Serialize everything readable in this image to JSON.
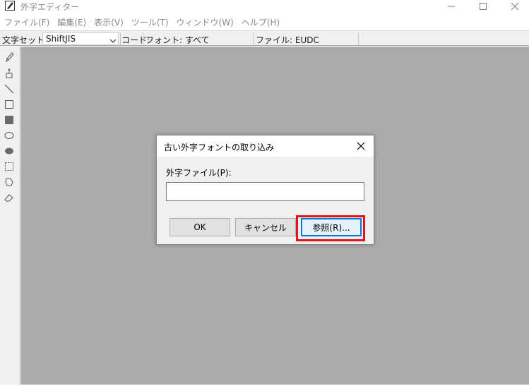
{
  "window": {
    "title": "外字エディター",
    "icon": "pencil-edit-icon",
    "controls": [
      "minimize-icon",
      "maximize-icon",
      "close-icon"
    ]
  },
  "menu": {
    "items": [
      {
        "label": "ファイル(F)"
      },
      {
        "label": "編集(E)"
      },
      {
        "label": "表示(V)"
      },
      {
        "label": "ツール(T)"
      },
      {
        "label": "ウィンドウ(W)"
      },
      {
        "label": "ヘルプ(H)"
      }
    ]
  },
  "toolbar": {
    "charset_label": "文字セット:",
    "charset_value": "ShiftJIS",
    "code_label": "コード:",
    "font_label": "フォント: すべて",
    "file_label": "ファイル: EUDC"
  },
  "palette": {
    "tools": [
      "pencil-icon",
      "brush-icon",
      "line-icon",
      "hollow-rectangle-icon",
      "filled-rectangle-icon",
      "hollow-ellipse-icon",
      "filled-ellipse-icon",
      "rectangular-selection-icon",
      "freeform-selection-icon",
      "eraser-icon"
    ]
  },
  "dialog": {
    "title": "古い外字フォントの取り込み",
    "file_label": "外字ファイル(P):",
    "file_value": "",
    "ok_label": "OK",
    "cancel_label": "キャンセル",
    "browse_label": "参照(R)..."
  },
  "colors": {
    "workarea": "#ababab",
    "chrome": "#f0f0f0",
    "focus_blue": "#0078d7",
    "highlight_red": "#e0151b"
  }
}
